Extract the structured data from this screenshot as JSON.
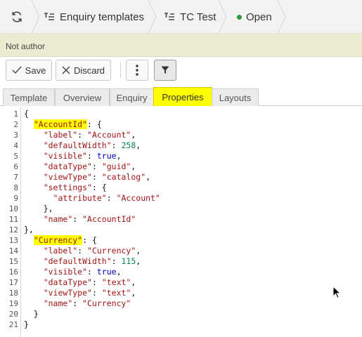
{
  "breadcrumb": {
    "items": [
      {
        "label": "Enquiry templates"
      },
      {
        "label": "TC Test"
      },
      {
        "label": "Open"
      }
    ],
    "status_color": "#2e9a3b"
  },
  "notice": {
    "text": "Not author"
  },
  "toolbar": {
    "save_label": "Save",
    "discard_label": "Discard"
  },
  "tabs": [
    {
      "label": "Template"
    },
    {
      "label": "Overview"
    },
    {
      "label": "Enquiry"
    },
    {
      "label": "Properties",
      "active": true
    },
    {
      "label": "Layouts"
    }
  ],
  "editor": {
    "highlight_color": "#ffff00",
    "lines": [
      {
        "n": "1",
        "indent": 0,
        "parts": [
          [
            "p",
            "{"
          ]
        ]
      },
      {
        "n": "2",
        "indent": 2,
        "parts": [
          [
            "khl",
            "\"AccountId\""
          ],
          [
            "p",
            ": {"
          ]
        ]
      },
      {
        "n": "3",
        "indent": 4,
        "parts": [
          [
            "k",
            "\"label\""
          ],
          [
            "p",
            ": "
          ],
          [
            "k",
            "\"Account\""
          ],
          [
            "p",
            ","
          ]
        ]
      },
      {
        "n": "4",
        "indent": 4,
        "parts": [
          [
            "k",
            "\"defaultWidth\""
          ],
          [
            "p",
            ": "
          ],
          [
            "n",
            "258"
          ],
          [
            "p",
            ","
          ]
        ]
      },
      {
        "n": "5",
        "indent": 4,
        "parts": [
          [
            "k",
            "\"visible\""
          ],
          [
            "p",
            ": "
          ],
          [
            "kw",
            "true"
          ],
          [
            "p",
            ","
          ]
        ]
      },
      {
        "n": "6",
        "indent": 4,
        "parts": [
          [
            "k",
            "\"dataType\""
          ],
          [
            "p",
            ": "
          ],
          [
            "k",
            "\"guid\""
          ],
          [
            "p",
            ","
          ]
        ]
      },
      {
        "n": "7",
        "indent": 4,
        "parts": [
          [
            "k",
            "\"viewType\""
          ],
          [
            "p",
            ": "
          ],
          [
            "k",
            "\"catalog\""
          ],
          [
            "p",
            ","
          ]
        ]
      },
      {
        "n": "8",
        "indent": 4,
        "parts": [
          [
            "k",
            "\"settings\""
          ],
          [
            "p",
            ": {"
          ]
        ]
      },
      {
        "n": "9",
        "indent": 6,
        "parts": [
          [
            "k",
            "\"attribute\""
          ],
          [
            "p",
            ": "
          ],
          [
            "k",
            "\"Account\""
          ]
        ]
      },
      {
        "n": "10",
        "indent": 4,
        "parts": [
          [
            "p",
            "},"
          ]
        ]
      },
      {
        "n": "11",
        "indent": 4,
        "parts": [
          [
            "k",
            "\"name\""
          ],
          [
            "p",
            ": "
          ],
          [
            "k",
            "\"AccountId\""
          ]
        ]
      },
      {
        "n": "12",
        "indent": 0,
        "parts": [
          [
            "p",
            "},"
          ]
        ]
      },
      {
        "n": "13",
        "indent": 2,
        "parts": [
          [
            "khl",
            "\"Currency\""
          ],
          [
            "p",
            ": {"
          ]
        ]
      },
      {
        "n": "14",
        "indent": 4,
        "parts": [
          [
            "k",
            "\"label\""
          ],
          [
            "p",
            ": "
          ],
          [
            "k",
            "\"Currency\""
          ],
          [
            "p",
            ","
          ]
        ]
      },
      {
        "n": "15",
        "indent": 4,
        "parts": [
          [
            "k",
            "\"defaultWidth\""
          ],
          [
            "p",
            ": "
          ],
          [
            "n",
            "115"
          ],
          [
            "p",
            ","
          ]
        ]
      },
      {
        "n": "16",
        "indent": 4,
        "parts": [
          [
            "k",
            "\"visible\""
          ],
          [
            "p",
            ": "
          ],
          [
            "kw",
            "true"
          ],
          [
            "p",
            ","
          ]
        ]
      },
      {
        "n": "17",
        "indent": 4,
        "parts": [
          [
            "k",
            "\"dataType\""
          ],
          [
            "p",
            ": "
          ],
          [
            "k",
            "\"text\""
          ],
          [
            "p",
            ","
          ]
        ]
      },
      {
        "n": "18",
        "indent": 4,
        "parts": [
          [
            "k",
            "\"viewType\""
          ],
          [
            "p",
            ": "
          ],
          [
            "k",
            "\"text\""
          ],
          [
            "p",
            ","
          ]
        ]
      },
      {
        "n": "19",
        "indent": 4,
        "parts": [
          [
            "k",
            "\"name\""
          ],
          [
            "p",
            ": "
          ],
          [
            "k",
            "\"Currency\""
          ]
        ]
      },
      {
        "n": "20",
        "indent": 2,
        "parts": [
          [
            "p",
            "}"
          ]
        ]
      },
      {
        "n": "21",
        "indent": 0,
        "parts": [
          [
            "p",
            "}"
          ]
        ]
      }
    ]
  }
}
